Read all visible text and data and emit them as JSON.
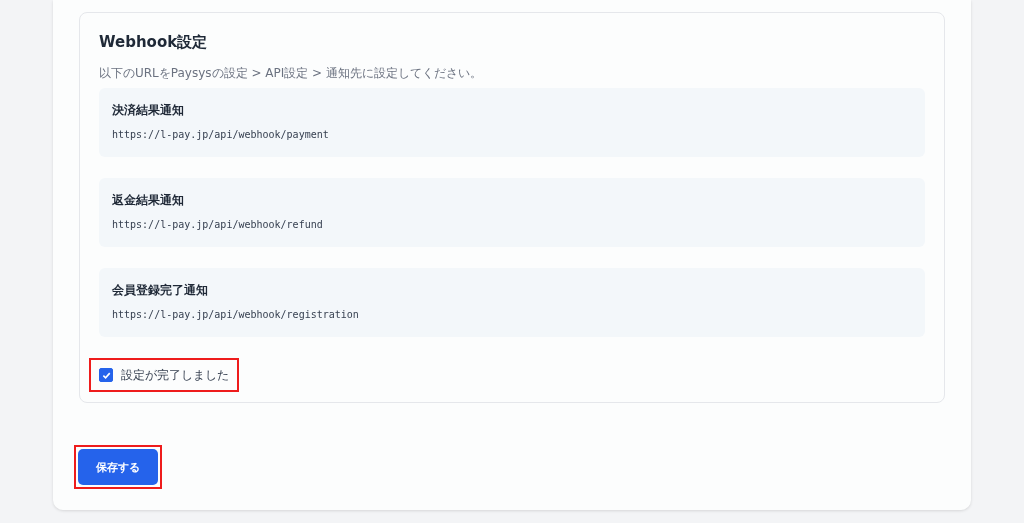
{
  "section": {
    "title": "Webhook設定",
    "description": "以下のURLをPaysysの設定 > API設定 > 通知先に設定してください。",
    "endpoints": [
      {
        "label": "決済結果通知",
        "url": "https://l-pay.jp/api/webhook/payment"
      },
      {
        "label": "返金結果通知",
        "url": "https://l-pay.jp/api/webhook/refund"
      },
      {
        "label": "会員登録完了通知",
        "url": "https://l-pay.jp/api/webhook/registration"
      }
    ],
    "confirm": {
      "label": "設定が完了しました",
      "checked": true,
      "highlighted": true
    }
  },
  "save_button": {
    "label": "保存する",
    "highlighted": true
  }
}
